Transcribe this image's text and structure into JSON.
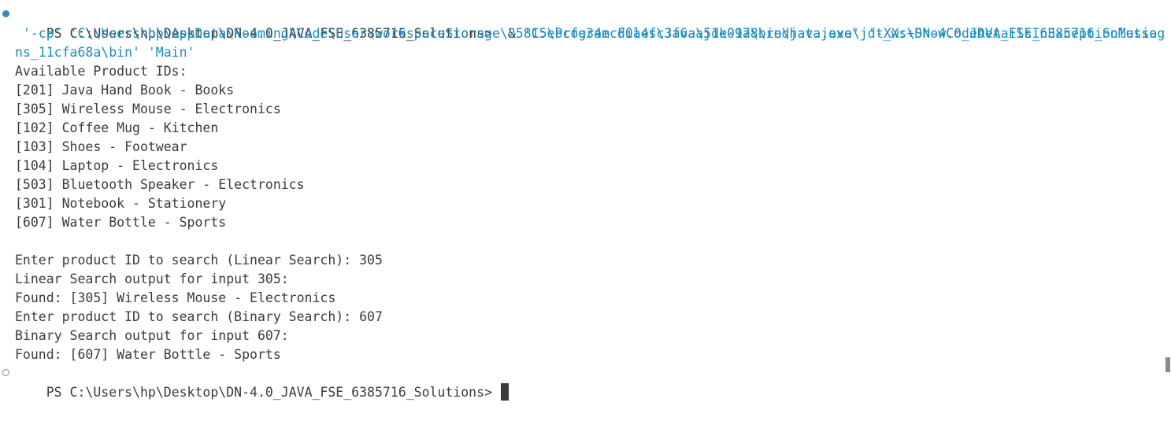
{
  "terminal": {
    "prompt": "PS C:\\Users\\hp\\Desktop\\DN-4.0_JAVA_FSE_6385716_Solutions>",
    "command": {
      "amp": "  & ",
      "exe": "'C:\\Program Files\\Java\\jdk-17\\bin\\java.exe'",
      "flag": " '-XX:+ShowCodeDetailsInExceptionMessages'",
      "cp_line": " '-cp' 'C:\\Users\\hp\\AppData\\Roaming\\Code\\User\\workspaceStorage\\25815ebcfe34ecd0a4fc3f6aa51e09a8\\redhat.java\\jdt_ws\\DN-4.0_JAVA_FSE_6385716_Solutio",
      "cp_wrap": "ns_11cfa68a\\bin' 'Main'"
    },
    "output": {
      "available_header": "Available Product IDs:",
      "products": [
        "[201] Java Hand Book - Books",
        "[305] Wireless Mouse - Electronics",
        "[102] Coffee Mug - Kitchen",
        "[103] Shoes - Footwear",
        "[104] Laptop - Electronics",
        "[503] Bluetooth Speaker - Electronics",
        "[301] Notebook - Stationery",
        "[607] Water Bottle - Sports"
      ],
      "linear_prompt": "Enter product ID to search (Linear Search): 305",
      "linear_header": "Linear Search output for input 305:",
      "linear_result": "Found: [305] Wireless Mouse - Electronics",
      "binary_prompt": "Enter product ID to search (Binary Search): 607",
      "binary_header": "Binary Search output for input 607:",
      "binary_result": "Found: [607] Water Bottle - Sports"
    },
    "final_prompt": "PS C:\\Users\\hp\\Desktop\\DN-4.0_JAVA_FSE_6385716_Solutions> "
  },
  "colors": {
    "background": "#ffffff",
    "text": "#3b3b3b",
    "string": "#1b8dbf",
    "decoration_success": "#2f87c8",
    "decoration_default": "#8a8a8a"
  },
  "icons": {
    "first_command_marker": "command-success-decoration-icon",
    "final_prompt_marker": "command-pending-decoration-icon"
  }
}
